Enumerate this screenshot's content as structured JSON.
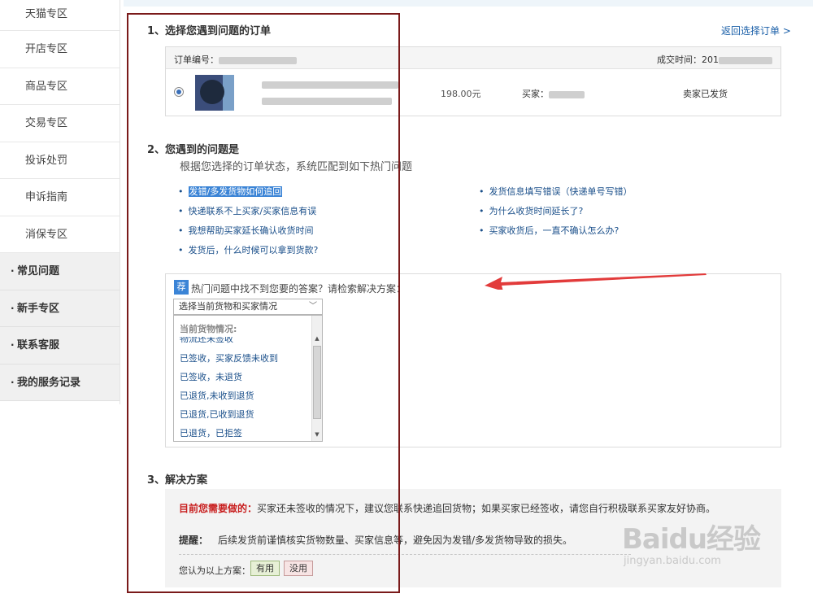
{
  "sidebar": {
    "sub_items": [
      "天猫专区",
      "开店专区",
      "商品专区",
      "交易专区",
      "投诉处罚",
      "申诉指南",
      "消保专区"
    ],
    "main_items": [
      "常见问题",
      "新手专区",
      "联系客服",
      "我的服务记录"
    ],
    "bullet": "·"
  },
  "section1": {
    "title": "1、选择您遇到问题的订单",
    "back_link": "返回选择订单 >",
    "order": {
      "number_label": "订单编号：",
      "time_label": "成交时间：201",
      "price": "198.00元",
      "buyer_label": "买家：",
      "status": "卖家已发货"
    }
  },
  "section2": {
    "title": "2、您遇到的问题是",
    "hint": "根据您选择的订单状态，系统匹配到如下热门问题",
    "questions_left": [
      "发错/多发货物如何追回",
      "快递联系不上买家/买家信息有误",
      "我想帮助买家延长确认收货时间",
      "发货后，什么时候可以拿到货款?"
    ],
    "questions_right": [
      "发货信息填写错误（快递单号写错）",
      "为什么收货时间延长了?",
      "买家收货后，一直不确认怎么办?"
    ],
    "tag": "荐",
    "search_text": "热门问题中找不到您要的答案？请检索解决方案：",
    "select_value": "选择当前货物和买家情况",
    "dropdown_group": "当前货物情况:",
    "dropdown_partial": "物流还未签收",
    "dropdown_options": [
      "已签收，买家反馈未收到",
      "已签收，未退货",
      "已退货,未收到退货",
      "已退货,已收到退货",
      "已退货，已拒签"
    ]
  },
  "section3": {
    "title": "3、解决方案",
    "need_label": "目前您需要做的：",
    "need_text": "买家还未签收的情况下，建议您联系快递追回货物；如果买家已经签收，请您自行积极联系买家友好协商。",
    "remind_label": "提醒：",
    "remind_text": "后续发货前谨慎核实货物数量、买家信息等，避免因为发错/多发货物导致的损失。",
    "feedback_label": "您认为以上方案：",
    "yes_label": "有用",
    "no_label": "没用"
  },
  "watermark": {
    "line1": "Baidu经验",
    "line2": "jingyan.baidu.com"
  },
  "colors": {
    "link": "#1a4f8a",
    "accent": "#3b84d6",
    "alert_red": "#c81d1d",
    "frame": "#7a1a1a",
    "arrow": "#e23b3b"
  }
}
